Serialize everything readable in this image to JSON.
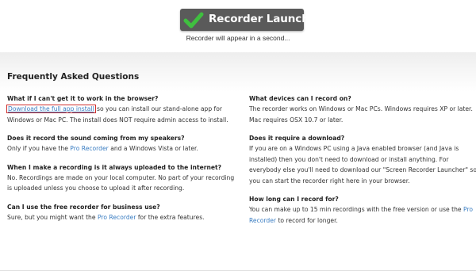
{
  "banner": {
    "title": "Recorder Launched!",
    "subtitle": "Recorder will appear in a second...",
    "icon": "check-icon",
    "check_color": "#3fbf3f",
    "badge_color": "#5a5a5a"
  },
  "faq": {
    "title": "Frequently Asked Questions",
    "link_color": "#3a7dc2",
    "left": [
      {
        "q": "What if I can't get it to work in the browser?",
        "link": "Download the full app install",
        "a_after": " so you can install our stand-alone app for Windows or Mac PC. The install does NOT require admin access to install."
      },
      {
        "q": "Does it record the sound coming from my speakers?",
        "a_before": "Only if you have the ",
        "link": "Pro Recorder",
        "a_after": " and a Windows Vista or later."
      },
      {
        "q": "When I make a recording is it always uploaded to the internet?",
        "a": "No. Recordings are made on your local computer. No part of your recording is uploaded unless you choose to upload it after recording."
      },
      {
        "q": "Can I use the free recorder for business use?",
        "a_before": "Sure, but you might want the ",
        "link": "Pro Recorder",
        "a_after": " for the extra features."
      }
    ],
    "right": [
      {
        "q": "What devices can I record on?",
        "a": "The recorder works on Windows or Mac PCs. Windows requires XP or later. Mac requires OSX 10.7 or later."
      },
      {
        "q": "Does it require a download?",
        "a": "If you are on a Windows PC using a Java enabled browser (and Java is installed) then you don't need to download or install anything. For everybody else you'll need to download our \"Screen Recorder Launcher\" so you can start the recorder right here in your browser."
      },
      {
        "q": "How long can I record for?",
        "a_before": "You can make up to 15 min recordings with the free version or use the ",
        "link": "Pro Recorder",
        "a_after": " to record for longer."
      }
    ]
  }
}
